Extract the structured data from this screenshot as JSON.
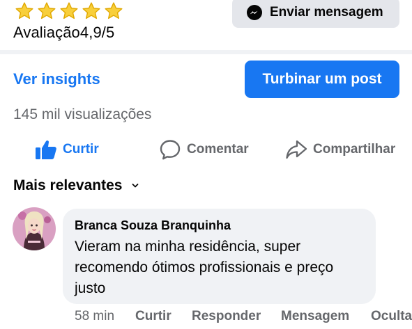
{
  "page_info": {
    "stars": 5,
    "rating_label": "Avaliação",
    "rating_value": "4,9/5",
    "send_message_label": "Enviar mensagem"
  },
  "post": {
    "insights_link": "Ver insights",
    "boost_button": "Turbinar um post",
    "views": "145 mil visualizações",
    "actions": {
      "like": "Curtir",
      "comment": "Comentar",
      "share": "Compartilhar"
    }
  },
  "comments": {
    "sort_label": "Mais relevantes",
    "items": [
      {
        "author": "Branca Souza Branquinha",
        "text": "Vieram na minha residência, super recomendo ótimos profissionais e preço justo",
        "time": "58 min",
        "like": "Curtir",
        "reply": "Responder",
        "message": "Mensagem",
        "hide": "Ocultar"
      }
    ]
  },
  "colors": {
    "accent": "#1877f2",
    "star": "#f5c518",
    "muted_text": "#65676b",
    "bubble": "#f0f2f5"
  }
}
